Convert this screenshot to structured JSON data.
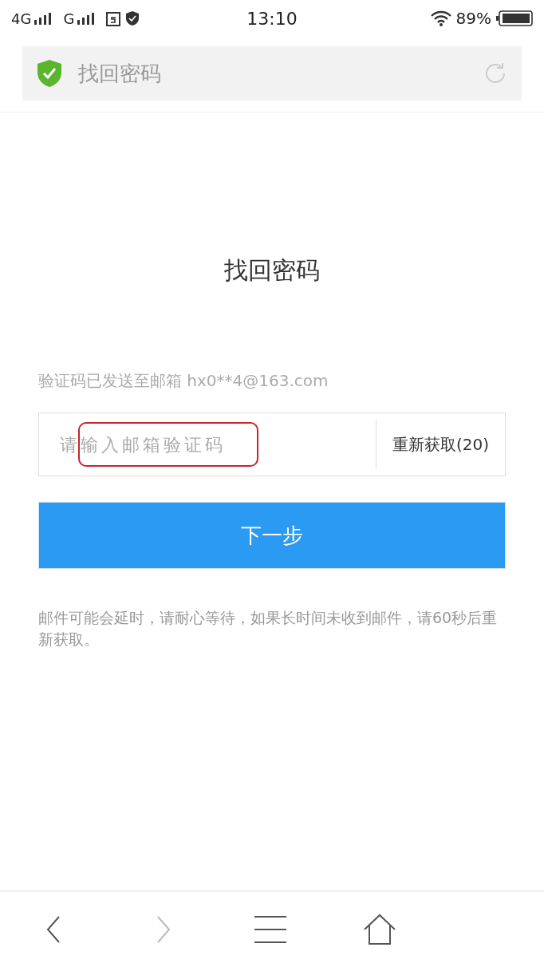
{
  "status_bar": {
    "networks": [
      {
        "label": "4G"
      },
      {
        "label": "G"
      }
    ],
    "time": "13:10",
    "battery": "89%"
  },
  "address_bar": {
    "title": "找回密码",
    "secure": true
  },
  "page": {
    "heading": "找回密码",
    "info": "验证码已发送至邮箱 hx0**4@163.com",
    "code_field": {
      "placeholder": "请输入邮箱验证码",
      "annotated": true
    },
    "resend_button": "重新获取(20)",
    "next_button": "下一步",
    "note": "邮件可能会延时，请耐心等待，如果长时间未收到邮件，请60秒后重新获取。"
  },
  "nav": [
    {
      "kind": "back",
      "disabled": false
    },
    {
      "kind": "forward",
      "disabled": true
    },
    {
      "kind": "menu",
      "disabled": false
    },
    {
      "kind": "home",
      "disabled": false
    }
  ]
}
